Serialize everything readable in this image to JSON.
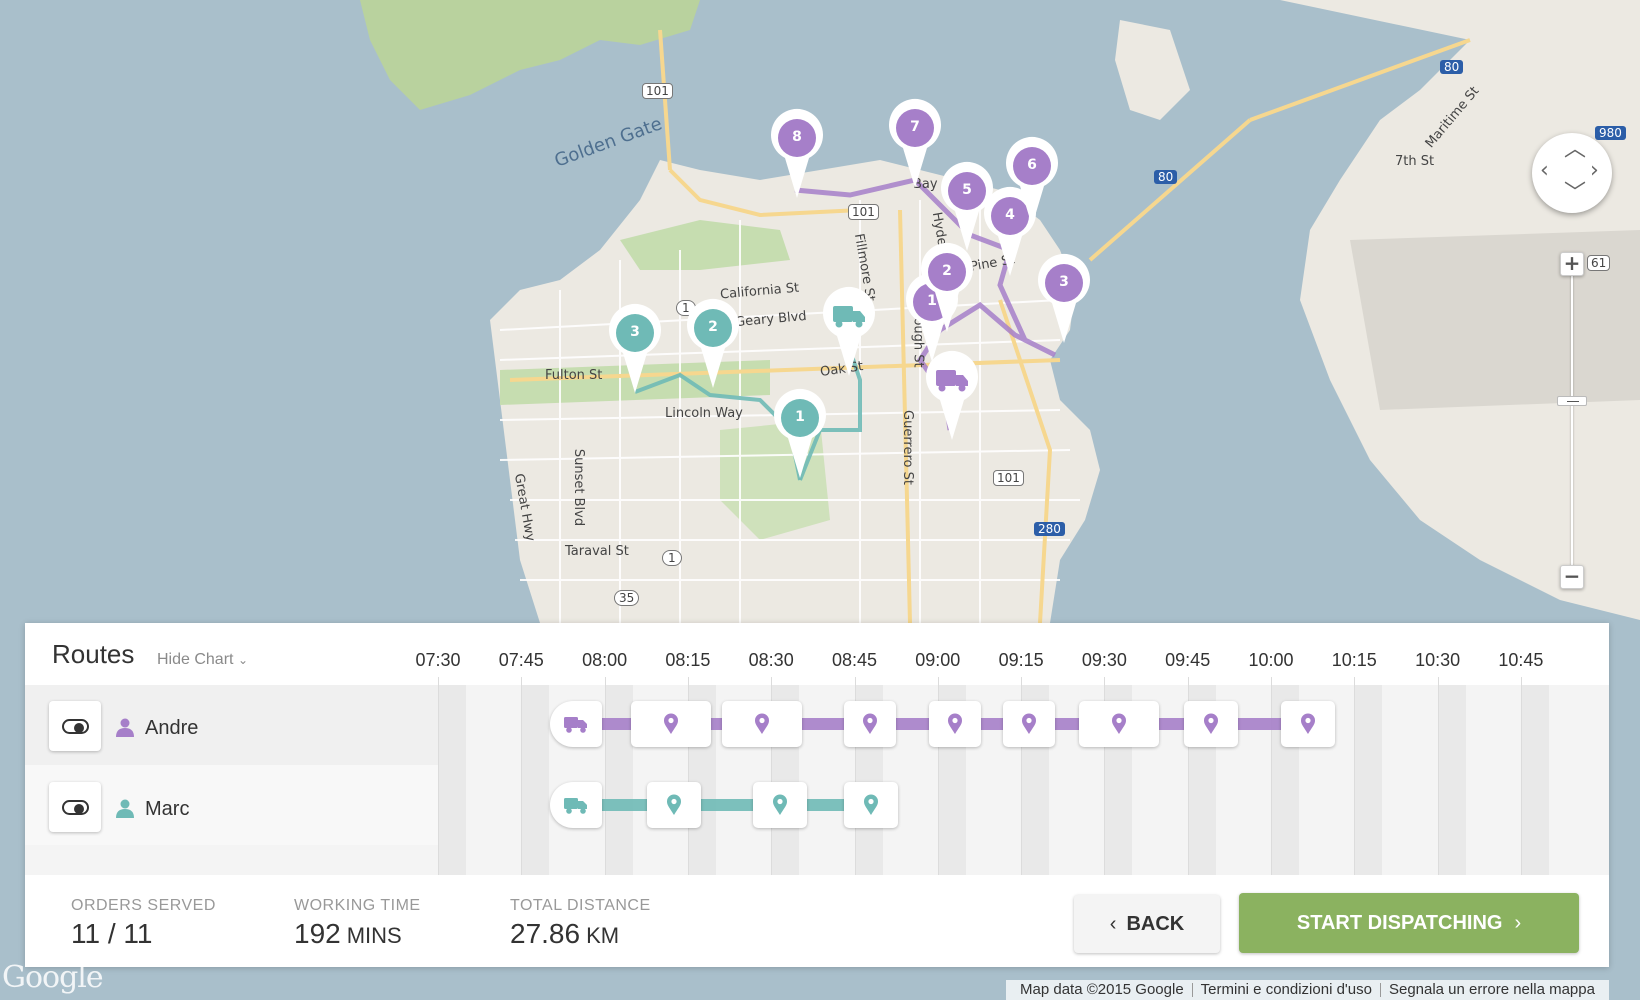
{
  "map": {
    "street_labels": [
      "Golden Gate",
      "California St",
      "Geary Blvd",
      "Fulton St",
      "Oak St",
      "Lincoln Way",
      "Sunset Blvd",
      "Great Hwy",
      "Taraval St",
      "Guerrero St",
      "Gough St",
      "Fillmore St",
      "Bay St",
      "Pine St",
      "7th St",
      "Maritime St",
      "Hyde St"
    ],
    "shield_labels": [
      "101",
      "101",
      "101",
      "1",
      "1",
      "35",
      "80",
      "80",
      "980",
      "61",
      "280"
    ],
    "route_colors": {
      "andre": "#a67fc9",
      "marc": "#6fbab6"
    },
    "andre_stops": [
      "1",
      "2",
      "3",
      "4",
      "5",
      "6",
      "7",
      "8"
    ],
    "marc_stops": [
      "1",
      "2",
      "3"
    ],
    "google_logo": "Google",
    "attribution": [
      "Map data ©2015 Google",
      "Termini e condizioni d'uso",
      "Segnala un errore nella mappa"
    ]
  },
  "controls": {
    "zoom_in": "+",
    "zoom_out": "−"
  },
  "panel": {
    "title": "Routes",
    "hide_chart": "Hide Chart",
    "hide_chart_icon": "chevron-down-icon",
    "time_ticks": [
      "07:30",
      "07:45",
      "08:00",
      "08:15",
      "08:30",
      "08:45",
      "09:00",
      "09:15",
      "09:30",
      "09:45",
      "10:00",
      "10:15",
      "10:30",
      "10:45"
    ],
    "drivers": [
      {
        "name": "Andre",
        "color": "#a67fc9",
        "enabled": true,
        "stops": 8
      },
      {
        "name": "Marc",
        "color": "#6fbab6",
        "enabled": true,
        "stops": 3
      }
    ]
  },
  "stats": {
    "orders": {
      "label": "ORDERS SERVED",
      "value": "11 / 11"
    },
    "working": {
      "label": "WORKING TIME",
      "value": "192",
      "unit": "MINS"
    },
    "distance": {
      "label": "TOTAL DISTANCE",
      "value": "27.86",
      "unit": "KM"
    }
  },
  "actions": {
    "back": "BACK",
    "back_icon": "chevron-left-icon",
    "start": "START DISPATCHING",
    "start_icon": "chevron-right-icon"
  }
}
